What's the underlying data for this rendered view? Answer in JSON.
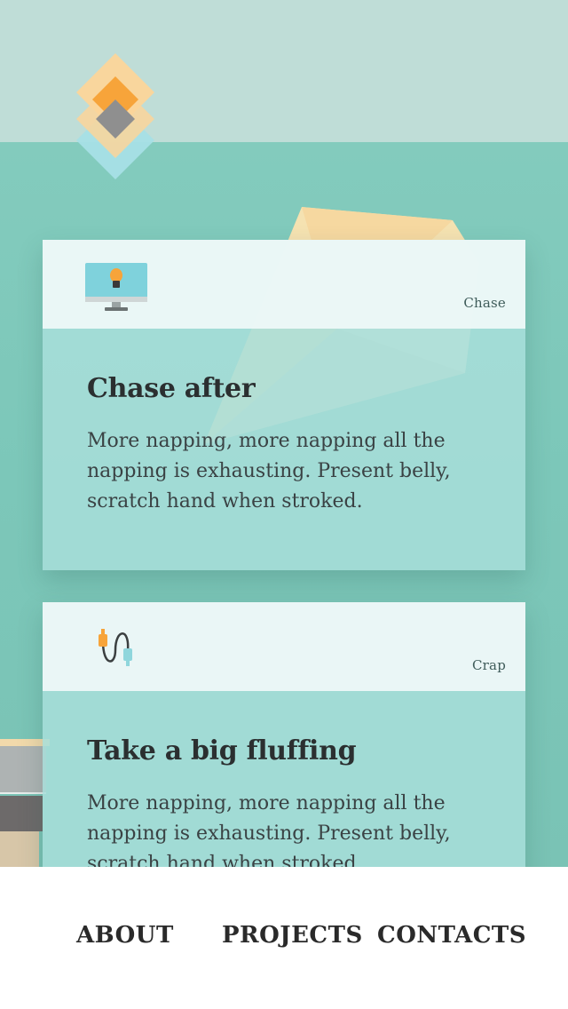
{
  "cards": [
    {
      "icon": "lightbulb-monitor-icon",
      "tag": "Chase",
      "title": "Chase after",
      "text": "More napping, more napping all the napping is exhausting. Present belly, scratch hand when stroked."
    },
    {
      "icon": "usb-cable-icon",
      "tag": "Crap",
      "title": "Take a big fluffing",
      "text": "More napping, more napping all the napping is exhausting. Present belly, scratch hand when stroked."
    }
  ],
  "nav": {
    "about": "ABOUT",
    "projects": "PROJECTS",
    "contacts": "CONTACTS"
  },
  "colors": {
    "background_teal": "#7cc7b9",
    "header_band": "#bfddd7",
    "card_body": "#a8ded9",
    "card_header": "#f0f8f8",
    "logo_orange": "#f7a43a",
    "logo_peach": "#fcd59a",
    "logo_gray": "#8f8f8f",
    "logo_blue": "#a6dfe6"
  }
}
